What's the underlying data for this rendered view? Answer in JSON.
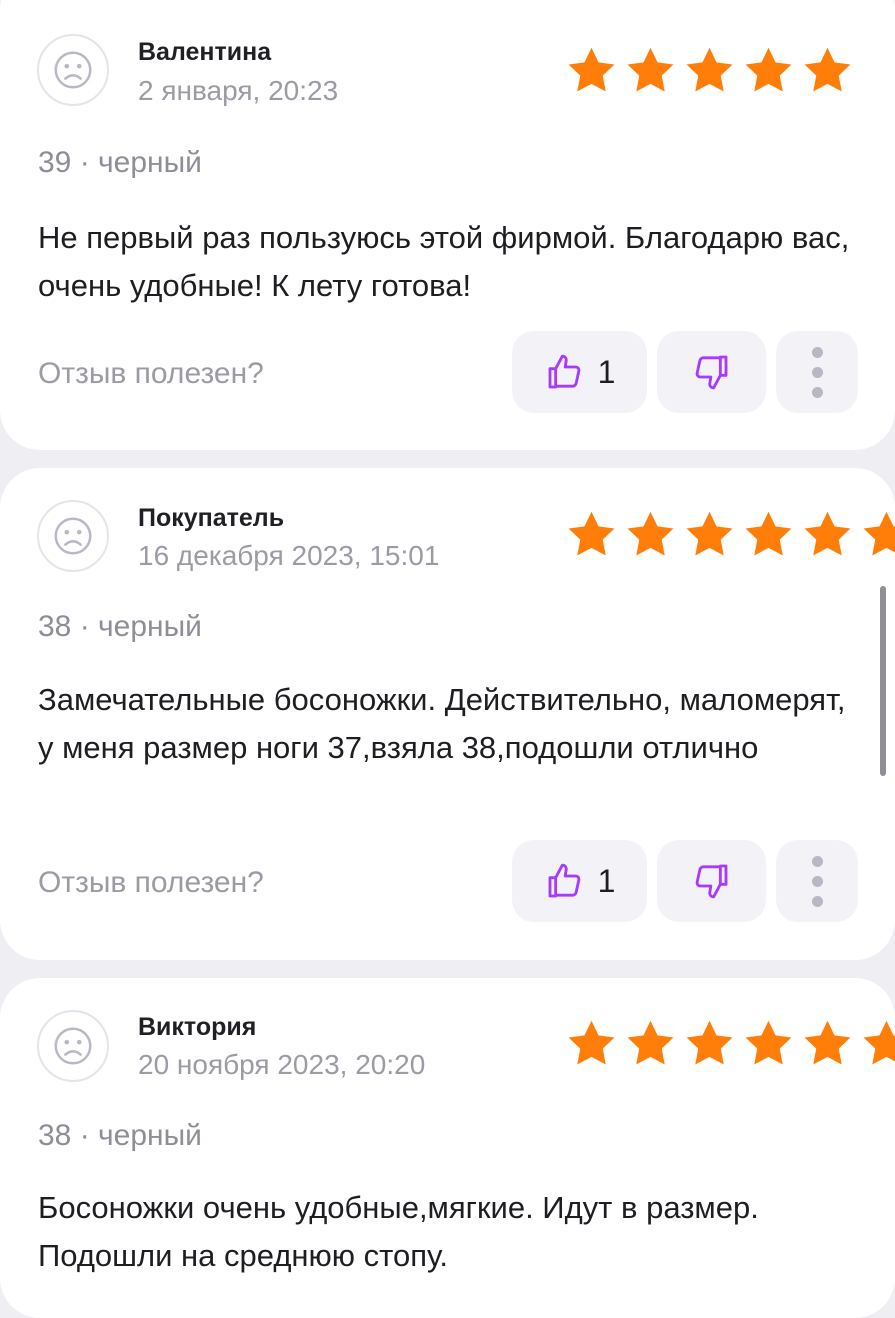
{
  "reviews": [
    {
      "author": "Валентина",
      "date": "2 января, 20:23",
      "rating": 5,
      "variant": "39 · черный",
      "text": "Не первый раз пользуюсь этой фирмой. Благодарю вас, очень удобные! К лету готова!",
      "helpful_label": "Отзыв полезен?",
      "likes": "1"
    },
    {
      "author": "Покупатель",
      "date": "16 декабря 2023, 15:01",
      "rating": 5,
      "variant": "38 · черный",
      "text": "Замечательные босоножки. Действительно, маломерят, у меня размер ноги 37,взяла 38,подошли отлично",
      "helpful_label": "Отзыв полезен?",
      "likes": "1"
    },
    {
      "author": "Виктория",
      "date": "20 ноября 2023, 20:20",
      "rating": 5,
      "variant": "38 · черный",
      "text": "Босоножки очень удобные,мягкие. Идут в размер. Подошли на среднюю стопу.",
      "helpful_label": "",
      "likes": ""
    }
  ],
  "icons": {
    "avatar": "sad-face-icon",
    "star": "star-icon",
    "like": "thumbs-up-icon",
    "dislike": "thumbs-down-icon",
    "more": "more-vertical-icon"
  },
  "colors": {
    "star": "#ff7e0a",
    "thumb": "#a73afd",
    "page_bg": "#eeeef3",
    "card_bg": "#ffffff",
    "button_bg": "#f3f2f7",
    "muted_text": "#9b9ba6"
  }
}
